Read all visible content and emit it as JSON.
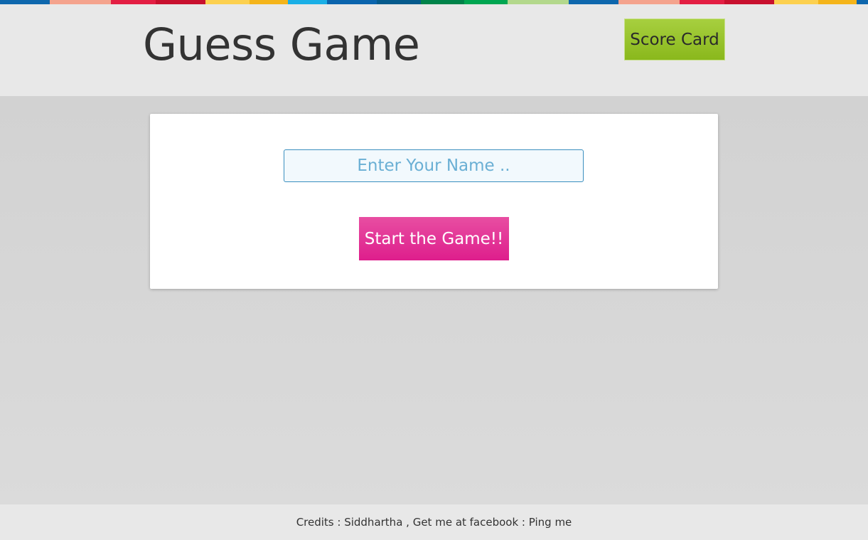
{
  "stripe_colors": [
    "#0e67ad",
    "#f4a38d",
    "#e31e43",
    "#c8102e",
    "#fcd04f",
    "#f4b41a",
    "#1aafe6",
    "#0a64ad",
    "#055a8c",
    "#00834a",
    "#00a651",
    "#b3d88c",
    "#0e67ad",
    "#f4a38d",
    "#e31e43",
    "#c8102e",
    "#fcd04f",
    "#f4b41a"
  ],
  "header": {
    "title": "Guess Game",
    "score_card_label": "Score Card"
  },
  "form": {
    "name_placeholder": "Enter Your Name ..",
    "name_value": "",
    "start_label": "Start the Game!!"
  },
  "footer": {
    "credits_prefix": "Credits : ",
    "author": "Siddhartha",
    "separator": " , ",
    "contact_prefix": "Get me at facebook : ",
    "contact_link": "Ping me"
  },
  "colors": {
    "score_button": "#98c22a",
    "start_button": "#e0278f",
    "input_border": "#3b8fbf"
  }
}
